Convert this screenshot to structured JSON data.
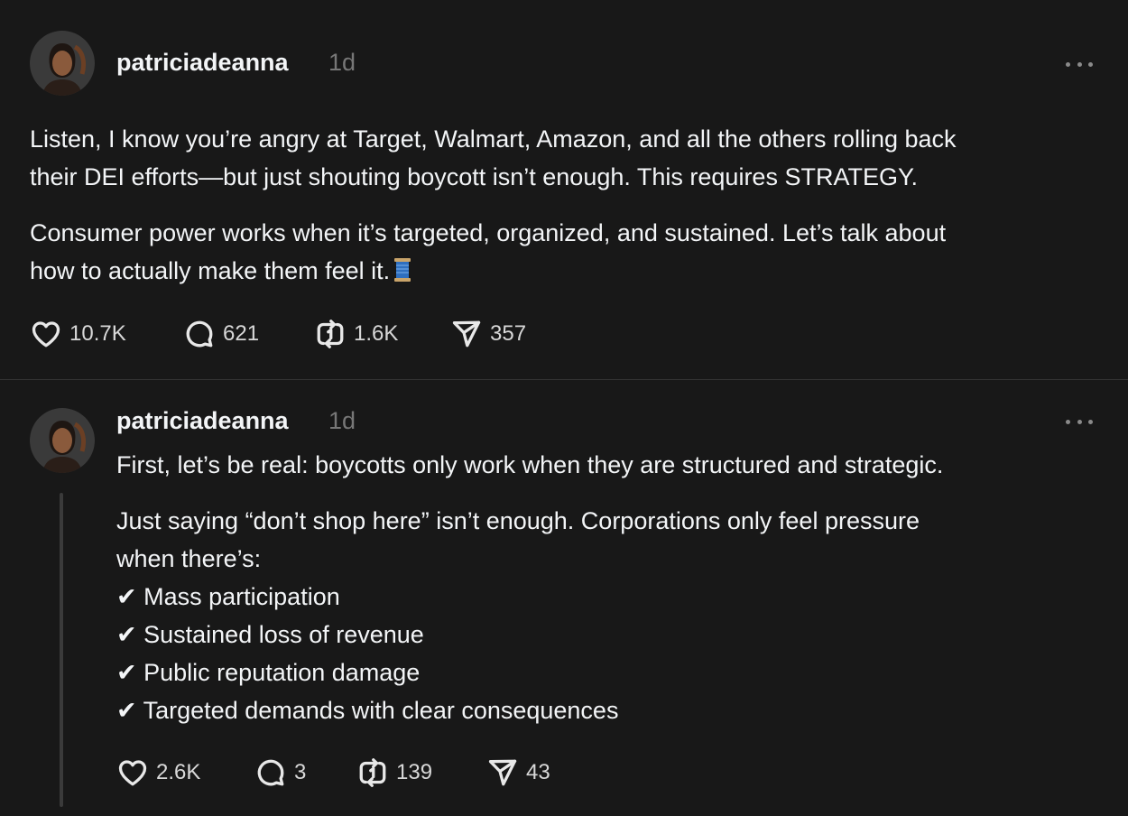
{
  "posts": [
    {
      "username": "patriciadeanna",
      "time": "1d",
      "paragraphs": [
        [
          "Listen, I know you’re angry at Target, Walmart, Amazon, and all the others rolling back",
          "their DEI efforts—but just shouting boycott isn’t enough. This requires STRATEGY."
        ],
        [
          "Consumer power works when it’s targeted, organized, and sustained. Let’s talk about",
          "how to actually make them feel it."
        ]
      ],
      "emoji_icon": "thread-spool-icon",
      "stats": {
        "likes": "10.7K",
        "replies": "621",
        "reposts": "1.6K",
        "shares": "357"
      }
    },
    {
      "username": "patriciadeanna",
      "time": "1d",
      "paragraphs": [
        [
          "First, let’s be real: boycotts only work when they are structured and strategic."
        ],
        [
          "Just saying “don’t shop here” isn’t enough. Corporations only feel pressure",
          "when there’s:",
          "✔ Mass participation",
          "✔ Sustained loss of revenue",
          "✔ Public reputation damage",
          "✔ Targeted demands with clear consequences"
        ]
      ],
      "stats": {
        "likes": "2.6K",
        "replies": "3",
        "reposts": "139",
        "shares": "43"
      }
    }
  ],
  "colors": {
    "background": "#181818",
    "text": "#f3f5f7",
    "muted": "#777777",
    "divider": "#333333"
  },
  "icons": [
    "heart-icon",
    "comment-icon",
    "repost-icon",
    "share-icon",
    "more-icon",
    "thread-spool-icon"
  ]
}
